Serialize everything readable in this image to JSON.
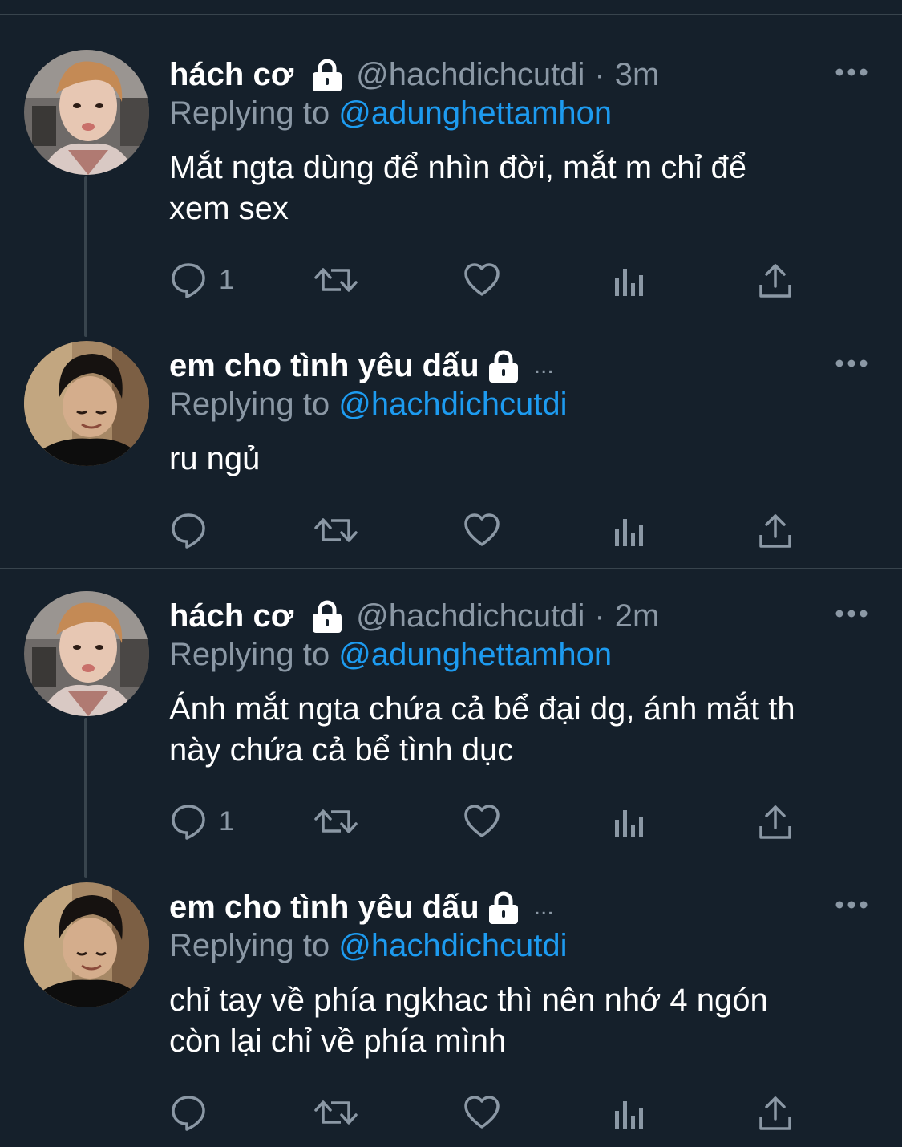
{
  "thread_1": {
    "tweet_a": {
      "name": "hách cơ",
      "handle": "@hachdichcutdi",
      "dot": "·",
      "time": "3m",
      "reply_prefix": "Replying to",
      "reply_handle": "@adunghettamhon",
      "text_line1": "Mắt ngta dùng để nhìn đời, mắt m chỉ để",
      "text_line2": "xem sex",
      "reply_count": "1"
    },
    "tweet_b": {
      "name": "em cho tình yêu dấu",
      "truncation": "...",
      "reply_prefix": "Replying to",
      "reply_handle": "@hachdichcutdi",
      "text_line1": "ru ngủ"
    }
  },
  "thread_2": {
    "tweet_a": {
      "name": "hách cơ",
      "handle": "@hachdichcutdi",
      "dot": "·",
      "time": "2m",
      "reply_prefix": "Replying to",
      "reply_handle": "@adunghettamhon",
      "text_line1": "Ánh mắt ngta chứa cả bể đại dg, ánh mắt th",
      "text_line2": "này chứa cả bể tình dục",
      "reply_count": "1"
    },
    "tweet_b": {
      "name": "em cho tình yêu dấu",
      "truncation": "...",
      "reply_prefix": "Replying to",
      "reply_handle": "@hachdichcutdi",
      "text_line1": "chỉ tay về phía ngkhac thì nên nhớ 4 ngón",
      "text_line2": "còn lại chỉ về phía mình"
    }
  },
  "icons": {
    "lock": "lock-icon",
    "more": "more-options-icon",
    "reply": "reply-icon",
    "retweet": "retweet-icon",
    "like": "heart-icon",
    "views": "views-icon",
    "share": "share-icon"
  },
  "colors": {
    "background": "#15202b",
    "divider": "#38444d",
    "secondary_text": "#8b98a5",
    "link": "#1d9bf0",
    "primary_text": "#ffffff"
  }
}
